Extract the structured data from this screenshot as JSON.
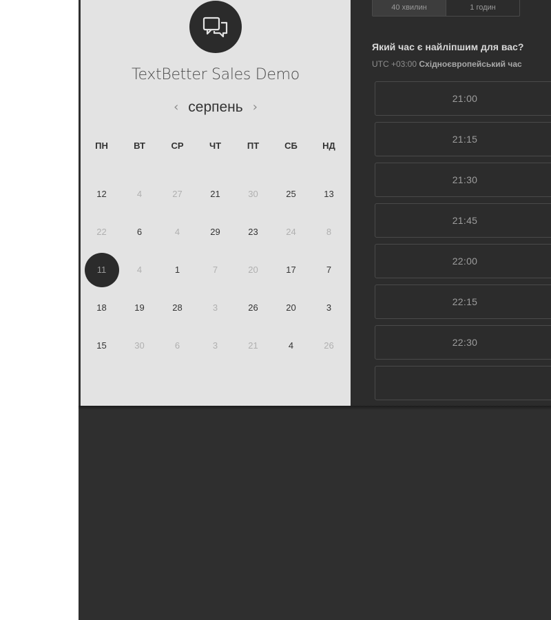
{
  "duration_options": [
    "40 хвилин",
    "1 годин"
  ],
  "question": "Який час є найліпшим для вас?",
  "timezone": {
    "offset": "UTC +03:00",
    "name": "Східноєвропейський час"
  },
  "event_title": "TextBetter Sales Demo",
  "calendar": {
    "month": "серпень",
    "prev_arrow": "‹",
    "next_arrow": "›",
    "weekdays": [
      "ПН",
      "ВТ",
      "СР",
      "ЧТ",
      "ПТ",
      "СБ",
      "НД"
    ],
    "weeks": [
      [
        {
          "n": "12",
          "a": 1
        },
        {
          "n": "4",
          "a": 0
        },
        {
          "n": "27",
          "a": 0
        },
        {
          "n": "21",
          "a": 1
        },
        {
          "n": "30",
          "a": 0
        },
        {
          "n": "25",
          "a": 1
        },
        {
          "n": "13",
          "a": 1
        }
      ],
      [
        {
          "n": "22",
          "a": 0
        },
        {
          "n": "6",
          "a": 1
        },
        {
          "n": "4",
          "a": 0
        },
        {
          "n": "29",
          "a": 1
        },
        {
          "n": "23",
          "a": 1
        },
        {
          "n": "24",
          "a": 0
        },
        {
          "n": "8",
          "a": 0
        }
      ],
      [
        {
          "n": "11",
          "a": 1,
          "sel": 1
        },
        {
          "n": "4",
          "a": 0
        },
        {
          "n": "1",
          "a": 1
        },
        {
          "n": "7",
          "a": 0
        },
        {
          "n": "20",
          "a": 0
        },
        {
          "n": "17",
          "a": 1
        },
        {
          "n": "7",
          "a": 1
        }
      ],
      [
        {
          "n": "18",
          "a": 1
        },
        {
          "n": "19",
          "a": 1
        },
        {
          "n": "28",
          "a": 1
        },
        {
          "n": "3",
          "a": 0
        },
        {
          "n": "26",
          "a": 1
        },
        {
          "n": "20",
          "a": 1
        },
        {
          "n": "3",
          "a": 1
        }
      ],
      [
        {
          "n": "15",
          "a": 1
        },
        {
          "n": "30",
          "a": 0
        },
        {
          "n": "6",
          "a": 0
        },
        {
          "n": "3",
          "a": 0
        },
        {
          "n": "21",
          "a": 0
        },
        {
          "n": "4",
          "a": 1
        },
        {
          "n": "26",
          "a": 0
        }
      ]
    ]
  },
  "time_slots": [
    "21:00",
    "21:15",
    "21:30",
    "21:45",
    "22:00",
    "22:15",
    "22:30",
    ""
  ]
}
